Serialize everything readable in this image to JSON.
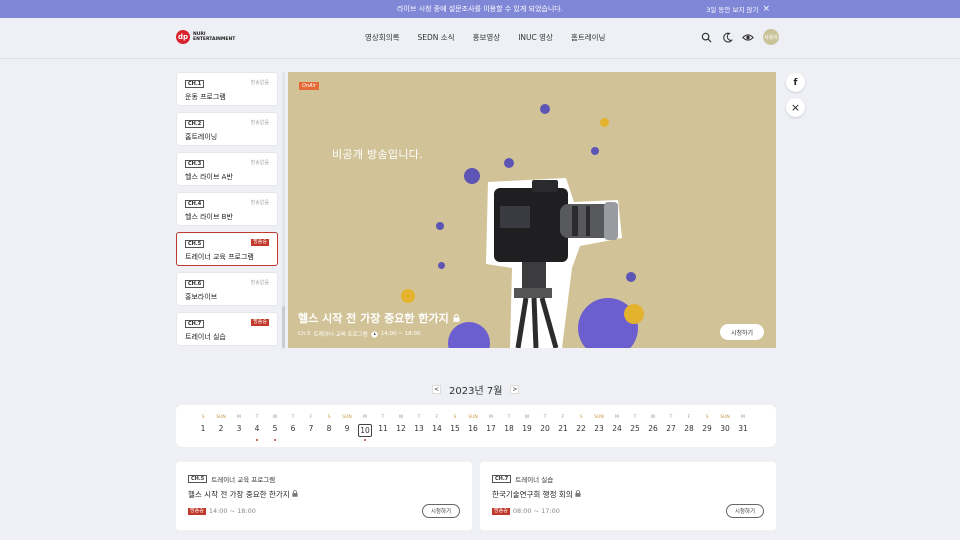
{
  "banner": {
    "message": "라이브 시청 중에 설문조사를 이용할 수 있게 되었습니다.",
    "dismiss_label": "3일 동안 보지 않기",
    "close_icon": "×"
  },
  "logo": {
    "mark": "dp",
    "line1": "NURI",
    "line2": "ENTERTAINMENT"
  },
  "nav": [
    "영상회의록",
    "SEDN 소식",
    "홍보영상",
    "INUC 영상",
    "홈트레이닝"
  ],
  "user": {
    "avatar_label": "사용자"
  },
  "channels": [
    {
      "tag": "CH.1",
      "status": "방송없음",
      "live": false,
      "name": "운동 프로그램"
    },
    {
      "tag": "CH.2",
      "status": "방송없음",
      "live": false,
      "name": "홈트레이닝"
    },
    {
      "tag": "CH.3",
      "status": "방송없음",
      "live": false,
      "name": "헬스 라이브 A반"
    },
    {
      "tag": "CH.4",
      "status": "방송없음",
      "live": false,
      "name": "헬스 라이브 B반"
    },
    {
      "tag": "CH.5",
      "status": "방송중",
      "live": true,
      "name": "트레이너 교육 프로그램"
    },
    {
      "tag": "CH.6",
      "status": "방송없음",
      "live": false,
      "name": "홍보라이브"
    },
    {
      "tag": "CH.7",
      "status": "방송중",
      "live": true,
      "name": "트레이너 실습"
    }
  ],
  "player": {
    "chip": "OnAir",
    "private_text": "비공개 방송입니다.",
    "title": "헬스 시작 전 가장 중요한 한가지",
    "meta_channel": "Ch.5",
    "meta_program": "트레이너 교육 프로그램",
    "meta_time": "14:00 ~ 18:00",
    "watch_label": "시청하기"
  },
  "social": {
    "facebook": "f",
    "close": "×"
  },
  "month": {
    "label": "2023년 7월",
    "prev": "<",
    "next": ">"
  },
  "calendar": [
    {
      "dw": "S",
      "d": "1",
      "wk": true,
      "mk": false
    },
    {
      "dw": "SUN",
      "d": "2",
      "wk": true,
      "mk": false
    },
    {
      "dw": "M",
      "d": "3",
      "wk": false,
      "mk": false
    },
    {
      "dw": "T",
      "d": "4",
      "wk": false,
      "mk": true
    },
    {
      "dw": "W",
      "d": "5",
      "wk": false,
      "mk": true
    },
    {
      "dw": "T",
      "d": "6",
      "wk": false,
      "mk": false
    },
    {
      "dw": "F",
      "d": "7",
      "wk": false,
      "mk": false
    },
    {
      "dw": "S",
      "d": "8",
      "wk": true,
      "mk": false
    },
    {
      "dw": "SUN",
      "d": "9",
      "wk": true,
      "mk": false
    },
    {
      "dw": "M",
      "d": "10",
      "wk": false,
      "mk": true,
      "sel": true
    },
    {
      "dw": "T",
      "d": "11",
      "wk": false,
      "mk": false
    },
    {
      "dw": "W",
      "d": "12",
      "wk": false,
      "mk": false
    },
    {
      "dw": "T",
      "d": "13",
      "wk": false,
      "mk": false
    },
    {
      "dw": "F",
      "d": "14",
      "wk": false,
      "mk": false
    },
    {
      "dw": "S",
      "d": "15",
      "wk": true,
      "mk": false
    },
    {
      "dw": "SUN",
      "d": "16",
      "wk": true,
      "mk": false
    },
    {
      "dw": "M",
      "d": "17",
      "wk": false,
      "mk": false
    },
    {
      "dw": "T",
      "d": "18",
      "wk": false,
      "mk": false
    },
    {
      "dw": "W",
      "d": "19",
      "wk": false,
      "mk": false
    },
    {
      "dw": "T",
      "d": "20",
      "wk": false,
      "mk": false
    },
    {
      "dw": "F",
      "d": "21",
      "wk": false,
      "mk": false
    },
    {
      "dw": "S",
      "d": "22",
      "wk": true,
      "mk": false
    },
    {
      "dw": "SUN",
      "d": "23",
      "wk": true,
      "mk": false
    },
    {
      "dw": "M",
      "d": "24",
      "wk": false,
      "mk": false
    },
    {
      "dw": "T",
      "d": "25",
      "wk": false,
      "mk": false
    },
    {
      "dw": "W",
      "d": "26",
      "wk": false,
      "mk": false
    },
    {
      "dw": "T",
      "d": "27",
      "wk": false,
      "mk": false
    },
    {
      "dw": "F",
      "d": "28",
      "wk": false,
      "mk": false
    },
    {
      "dw": "S",
      "d": "29",
      "wk": true,
      "mk": false
    },
    {
      "dw": "SUN",
      "d": "30",
      "wk": true,
      "mk": false
    },
    {
      "dw": "M",
      "d": "31",
      "wk": false,
      "mk": false
    }
  ],
  "cards": [
    {
      "tag": "CH.5",
      "program": "트레이너 교육 프로그램",
      "title": "헬스 시작 전 가장 중요한 한가지",
      "status": "방송중",
      "time": "14:00 ~ 18:00",
      "button": "시청하기"
    },
    {
      "tag": "CH.7",
      "program": "트레이너 실습",
      "title": "한국기술연구회 행정 회의",
      "status": "방송중",
      "time": "08:00 ~ 17:00",
      "button": "시청하기"
    }
  ]
}
